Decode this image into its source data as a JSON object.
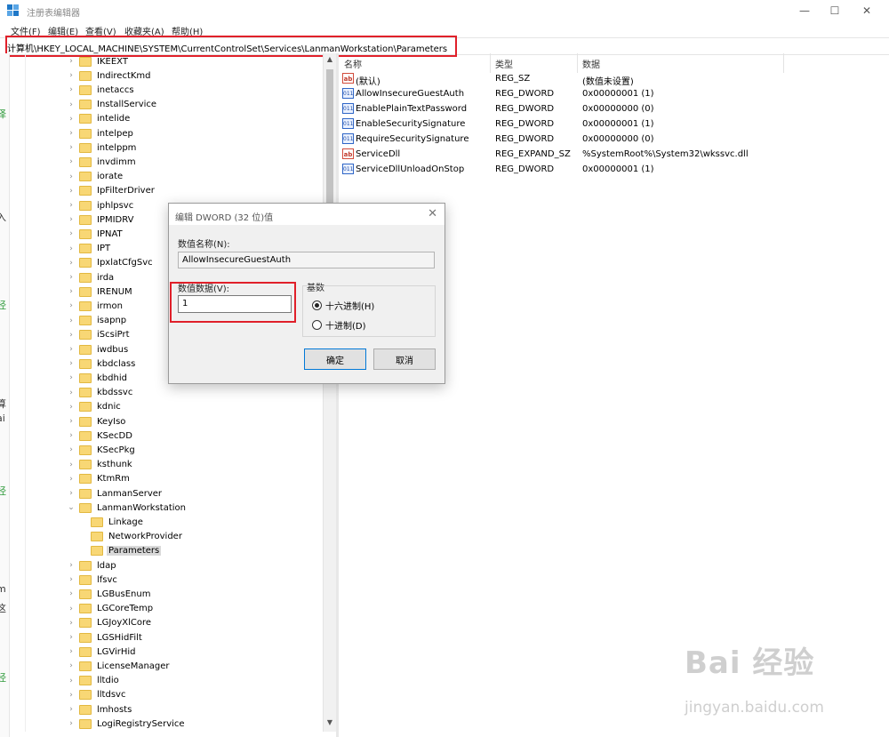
{
  "window": {
    "title": "注册表编辑器",
    "controls": {
      "minimize": "—",
      "maximize": "☐",
      "close": "✕"
    }
  },
  "menu": [
    "文件(F)",
    "编辑(E)",
    "查看(V)",
    "收藏夹(A)",
    "帮助(H)"
  ],
  "address": {
    "path": "计算机\\HKEY_LOCAL_MACHINE\\SYSTEM\\CurrentControlSet\\Services\\LanmanWorkstation\\Parameters"
  },
  "left_edge_chars": [
    "译",
    "入",
    "经",
    "算",
    "ai",
    "经",
    "m",
    "这",
    "经"
  ],
  "tree": {
    "items": [
      {
        "label": "IKEEXT",
        "level": 0,
        "expandable": true
      },
      {
        "label": "IndirectKmd",
        "level": 0,
        "expandable": true
      },
      {
        "label": "inetaccs",
        "level": 0,
        "expandable": true
      },
      {
        "label": "InstallService",
        "level": 0,
        "expandable": true
      },
      {
        "label": "intelide",
        "level": 0,
        "expandable": true
      },
      {
        "label": "intelpep",
        "level": 0,
        "expandable": true
      },
      {
        "label": "intelppm",
        "level": 0,
        "expandable": true
      },
      {
        "label": "invdimm",
        "level": 0,
        "expandable": true
      },
      {
        "label": "iorate",
        "level": 0,
        "expandable": true
      },
      {
        "label": "IpFilterDriver",
        "level": 0,
        "expandable": true
      },
      {
        "label": "iphlpsvc",
        "level": 0,
        "expandable": true
      },
      {
        "label": "IPMIDRV",
        "level": 0,
        "expandable": true
      },
      {
        "label": "IPNAT",
        "level": 0,
        "expandable": true
      },
      {
        "label": "IPT",
        "level": 0,
        "expandable": true
      },
      {
        "label": "IpxlatCfgSvc",
        "level": 0,
        "expandable": true
      },
      {
        "label": "irda",
        "level": 0,
        "expandable": true
      },
      {
        "label": "IRENUM",
        "level": 0,
        "expandable": true
      },
      {
        "label": "irmon",
        "level": 0,
        "expandable": true
      },
      {
        "label": "isapnp",
        "level": 0,
        "expandable": true
      },
      {
        "label": "iScsiPrt",
        "level": 0,
        "expandable": true
      },
      {
        "label": "iwdbus",
        "level": 0,
        "expandable": true
      },
      {
        "label": "kbdclass",
        "level": 0,
        "expandable": true
      },
      {
        "label": "kbdhid",
        "level": 0,
        "expandable": true
      },
      {
        "label": "kbdssvc",
        "level": 0,
        "expandable": true
      },
      {
        "label": "kdnic",
        "level": 0,
        "expandable": true
      },
      {
        "label": "KeyIso",
        "level": 0,
        "expandable": true
      },
      {
        "label": "KSecDD",
        "level": 0,
        "expandable": true
      },
      {
        "label": "KSecPkg",
        "level": 0,
        "expandable": true
      },
      {
        "label": "ksthunk",
        "level": 0,
        "expandable": true
      },
      {
        "label": "KtmRm",
        "level": 0,
        "expandable": true
      },
      {
        "label": "LanmanServer",
        "level": 0,
        "expandable": true
      },
      {
        "label": "LanmanWorkstation",
        "level": 0,
        "expandable": true,
        "expanded": true
      },
      {
        "label": "Linkage",
        "level": 1,
        "expandable": false
      },
      {
        "label": "NetworkProvider",
        "level": 1,
        "expandable": false
      },
      {
        "label": "Parameters",
        "level": 1,
        "expandable": false,
        "selected": true
      },
      {
        "label": "ldap",
        "level": 0,
        "expandable": true
      },
      {
        "label": "lfsvc",
        "level": 0,
        "expandable": true
      },
      {
        "label": "LGBusEnum",
        "level": 0,
        "expandable": true
      },
      {
        "label": "LGCoreTemp",
        "level": 0,
        "expandable": true
      },
      {
        "label": "LGJoyXlCore",
        "level": 0,
        "expandable": true
      },
      {
        "label": "LGSHidFilt",
        "level": 0,
        "expandable": true
      },
      {
        "label": "LGVirHid",
        "level": 0,
        "expandable": true
      },
      {
        "label": "LicenseManager",
        "level": 0,
        "expandable": true
      },
      {
        "label": "lltdio",
        "level": 0,
        "expandable": true
      },
      {
        "label": "lltdsvc",
        "level": 0,
        "expandable": true
      },
      {
        "label": "lmhosts",
        "level": 0,
        "expandable": true
      },
      {
        "label": "LogiRegistryService",
        "level": 0,
        "expandable": true
      }
    ]
  },
  "list": {
    "columns": [
      "名称",
      "类型",
      "数据"
    ],
    "rows": [
      {
        "icon": "string-value-icon",
        "icon_text": "ab",
        "name": "(默认)",
        "type": "REG_SZ",
        "data": "(数值未设置)"
      },
      {
        "icon": "binary-value-icon",
        "icon_text": "011",
        "name": "AllowInsecureGuestAuth",
        "type": "REG_DWORD",
        "data": "0x00000001 (1)"
      },
      {
        "icon": "binary-value-icon",
        "icon_text": "011",
        "name": "EnablePlainTextPassword",
        "type": "REG_DWORD",
        "data": "0x00000000 (0)"
      },
      {
        "icon": "binary-value-icon",
        "icon_text": "011",
        "name": "EnableSecuritySignature",
        "type": "REG_DWORD",
        "data": "0x00000001 (1)"
      },
      {
        "icon": "binary-value-icon",
        "icon_text": "011",
        "name": "RequireSecuritySignature",
        "type": "REG_DWORD",
        "data": "0x00000000 (0)"
      },
      {
        "icon": "string-value-icon",
        "icon_text": "ab",
        "name": "ServiceDll",
        "type": "REG_EXPAND_SZ",
        "data": "%SystemRoot%\\System32\\wkssvc.dll"
      },
      {
        "icon": "binary-value-icon",
        "icon_text": "011",
        "name": "ServiceDllUnloadOnStop",
        "type": "REG_DWORD",
        "data": "0x00000001 (1)"
      }
    ]
  },
  "dialog": {
    "title": "编辑 DWORD (32 位)值",
    "close": "✕",
    "name_label": "数值名称(N):",
    "name_value": "AllowInsecureGuestAuth",
    "data_label": "数值数据(V):",
    "data_value": "1",
    "base_label": "基数",
    "hex_label": "十六进制(H)",
    "dec_label": "十进制(D)",
    "selected_base": "hex",
    "ok_label": "确定",
    "cancel_label": "取消"
  },
  "watermark": {
    "brand": "Bai 经验",
    "url": "jingyan.baidu.com"
  },
  "colors": {
    "highlight": "#e0202a",
    "folder": "#f8d775",
    "accent": "#0078d7"
  }
}
